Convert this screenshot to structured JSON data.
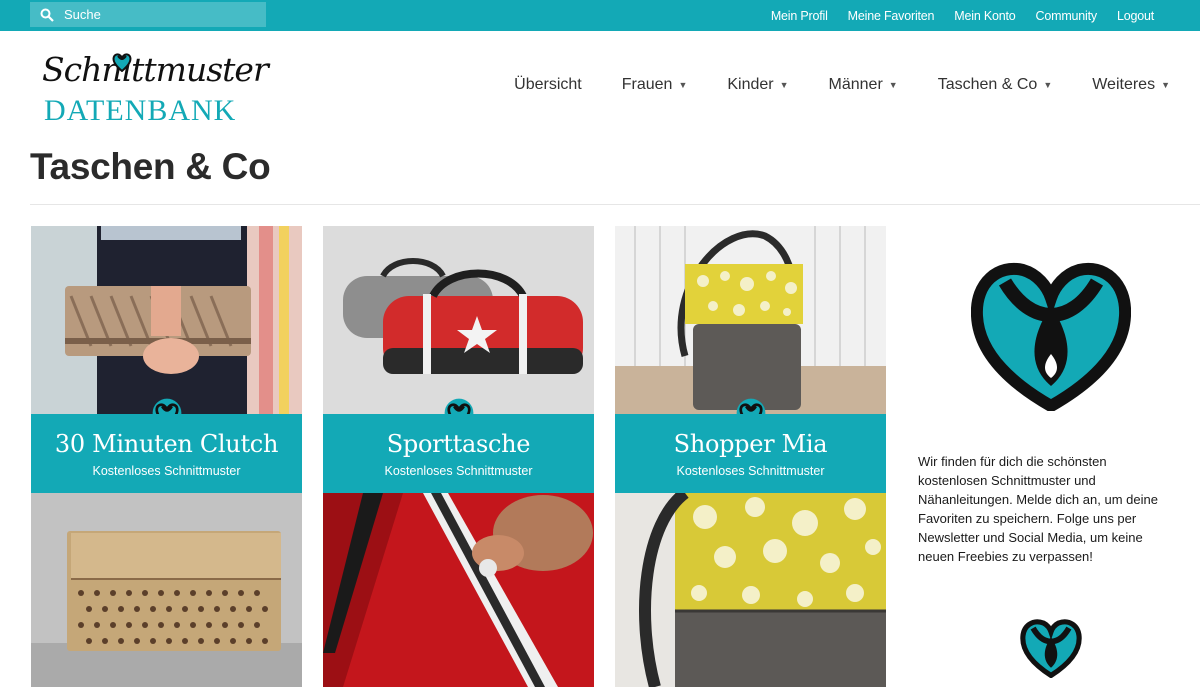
{
  "topbar": {
    "search_placeholder": "Suche",
    "links": [
      "Mein Profil",
      "Meine Favoriten",
      "Mein Konto",
      "Community",
      "Logout"
    ]
  },
  "logo": {
    "script_text": "Schnittmuster",
    "brand_text": "DATENBANK"
  },
  "nav": {
    "items": [
      {
        "label": "Übersicht",
        "has_dropdown": false
      },
      {
        "label": "Frauen",
        "has_dropdown": true
      },
      {
        "label": "Kinder",
        "has_dropdown": true
      },
      {
        "label": "Männer",
        "has_dropdown": true
      },
      {
        "label": "Taschen & Co",
        "has_dropdown": true
      },
      {
        "label": "Weiteres",
        "has_dropdown": true
      }
    ]
  },
  "page": {
    "title": "Taschen & Co"
  },
  "cards": [
    {
      "title": "30 Minuten Clutch",
      "subtitle": "Kostenloses Schnittmuster"
    },
    {
      "title": "Sporttasche",
      "subtitle": "Kostenloses Schnittmuster"
    },
    {
      "title": "Shopper Mia",
      "subtitle": "Kostenloses Schnittmuster"
    }
  ],
  "sidebar": {
    "info_text": "Wir finden für dich die schönsten kostenlosen Schnittmuster und Nähanleitungen. Melde dich an, um deine Favoriten zu speichern. Folge uns per Newsletter und Social Media, um keine neuen Freebies zu verpassen!"
  },
  "colors": {
    "accent": "#13a9b6",
    "text": "#333333",
    "logo_dark": "#111111"
  },
  "icons": {
    "search": "search-icon",
    "caret": "caret-down-icon",
    "brand": "heart-logo-icon"
  }
}
